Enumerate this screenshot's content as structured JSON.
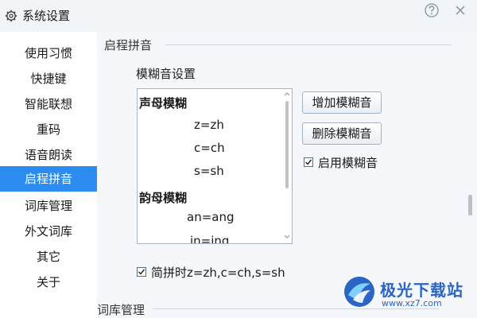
{
  "window": {
    "title": "系统设置"
  },
  "sidebar": {
    "items": [
      {
        "label": "使用习惯"
      },
      {
        "label": "快捷键"
      },
      {
        "label": "智能联想"
      },
      {
        "label": "重码"
      },
      {
        "label": "语音朗读"
      },
      {
        "label": "启程拼音",
        "active": true
      },
      {
        "label": "词库管理"
      },
      {
        "label": "外文词库"
      },
      {
        "label": "其它"
      },
      {
        "label": "关于"
      }
    ]
  },
  "main": {
    "section_title": "启程拼音",
    "fuzzy_heading": "模糊音设置",
    "list": {
      "initials_header": "声母模糊",
      "initials": [
        "z=zh",
        "c=ch",
        "s=sh"
      ],
      "finals_header": "韵母模糊",
      "finals": [
        "an=ang",
        "in=ing"
      ]
    },
    "buttons": {
      "add": "增加模糊音",
      "delete": "删除模糊音"
    },
    "enable_fuzzy": {
      "label": "启用模糊音",
      "checked": true
    },
    "abbrev": {
      "label": "简拼时z=zh,c=ch,s=sh",
      "checked": true
    },
    "next_section_title": "词库管理"
  },
  "watermark": {
    "name": "极光下载站",
    "url": "www.xz7.com"
  },
  "colors": {
    "accent": "#2d8cf0",
    "sidebar_bg": "#ffffff",
    "content_bg": "#f5f7fa"
  }
}
